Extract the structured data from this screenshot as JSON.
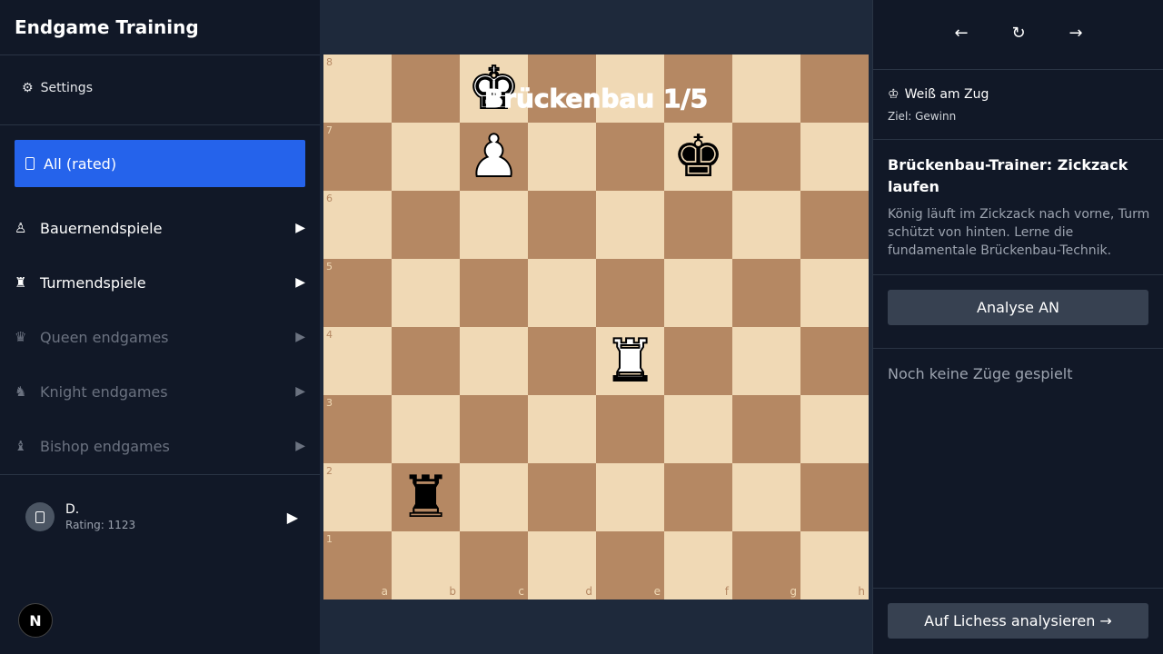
{
  "app": {
    "title": "Endgame Training"
  },
  "sidebar": {
    "settings": {
      "icon": "⚙",
      "label": "Settings"
    },
    "all_rated": {
      "label": "All (rated)"
    },
    "categories": [
      {
        "icon": "♙",
        "label": "Bauernendspiele",
        "arrow": "▶",
        "enabled": true
      },
      {
        "icon": "♜",
        "label": "Turmendspiele",
        "arrow": "▶",
        "enabled": true
      },
      {
        "icon": "♛",
        "label": "Queen endgames",
        "arrow": "▶",
        "enabled": false
      },
      {
        "icon": "♞",
        "label": "Knight endgames",
        "arrow": "▶",
        "enabled": false
      },
      {
        "icon": "♝",
        "label": "Bishop endgames",
        "arrow": "▶",
        "enabled": false
      }
    ],
    "user": {
      "name": "D.",
      "rating": "Rating: 1123",
      "arrow": "▶"
    },
    "badge": "N"
  },
  "board": {
    "overlay_title": "Brückenbau 1/5",
    "files": [
      "a",
      "b",
      "c",
      "d",
      "e",
      "f",
      "g",
      "h"
    ],
    "ranks": [
      "8",
      "7",
      "6",
      "5",
      "4",
      "3",
      "2",
      "1"
    ],
    "pieces": [
      {
        "square": "c8",
        "glyph": "♚",
        "color": "white",
        "name": "white-king"
      },
      {
        "square": "c7",
        "glyph": "♟",
        "color": "white",
        "name": "white-pawn"
      },
      {
        "square": "f7",
        "glyph": "♚",
        "color": "black",
        "name": "black-king"
      },
      {
        "square": "e4",
        "glyph": "♜",
        "color": "white",
        "name": "white-rook"
      },
      {
        "square": "b2",
        "glyph": "♜",
        "color": "black",
        "name": "black-rook"
      }
    ]
  },
  "panel": {
    "nav": {
      "back": "←",
      "reset": "↻",
      "forward": "→"
    },
    "turn_icon": "♔",
    "turn": "Weiß am Zug",
    "goal": "Ziel: Gewinn",
    "position_title": "Brückenbau-Trainer: Zickzack laufen",
    "position_desc": "König läuft im Zickzack nach vorne, Turm schützt von hinten. Lerne die fundamentale Brückenbau-Technik.",
    "analysis_button": "Analyse AN",
    "no_moves": "Noch keine Züge gespielt",
    "lichess_button": "Auf Lichess analysieren →"
  }
}
